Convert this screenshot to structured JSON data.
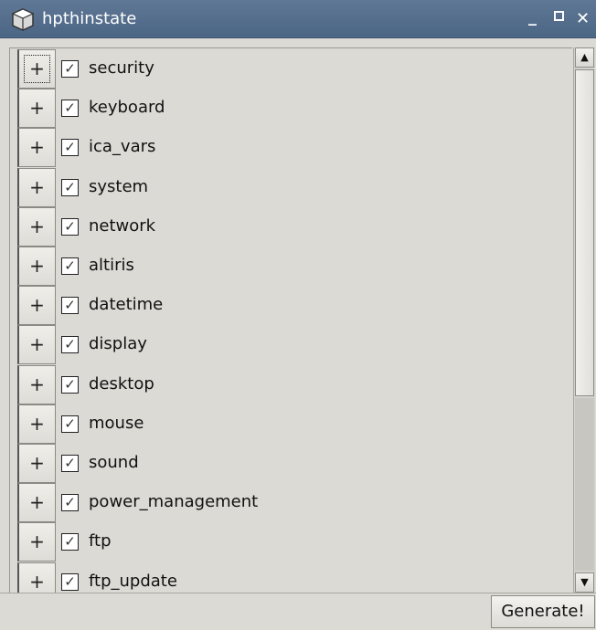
{
  "window": {
    "title": "hpthinstate",
    "minimize_glyph": "_",
    "close_glyph": "✕",
    "icon": "cube-app-icon"
  },
  "tree": {
    "expander_glyph": "+",
    "checkbox_glyph": "✓",
    "items": [
      {
        "label": "security",
        "checked": true,
        "focused": true
      },
      {
        "label": "keyboard",
        "checked": true
      },
      {
        "label": "ica_vars",
        "checked": true
      },
      {
        "label": "system",
        "checked": true
      },
      {
        "label": "network",
        "checked": true
      },
      {
        "label": "altiris",
        "checked": true
      },
      {
        "label": "datetime",
        "checked": true
      },
      {
        "label": "display",
        "checked": true
      },
      {
        "label": "desktop",
        "checked": true
      },
      {
        "label": "mouse",
        "checked": true
      },
      {
        "label": "sound",
        "checked": true
      },
      {
        "label": "power_management",
        "checked": true
      },
      {
        "label": "ftp",
        "checked": true
      },
      {
        "label": "ftp_update",
        "checked": true
      }
    ]
  },
  "scrollbar": {
    "up_glyph": "▲",
    "down_glyph": "▼"
  },
  "footer": {
    "generate_label": "Generate!"
  },
  "colors": {
    "titlebar": "#4b6584",
    "background": "#dcdad5"
  }
}
